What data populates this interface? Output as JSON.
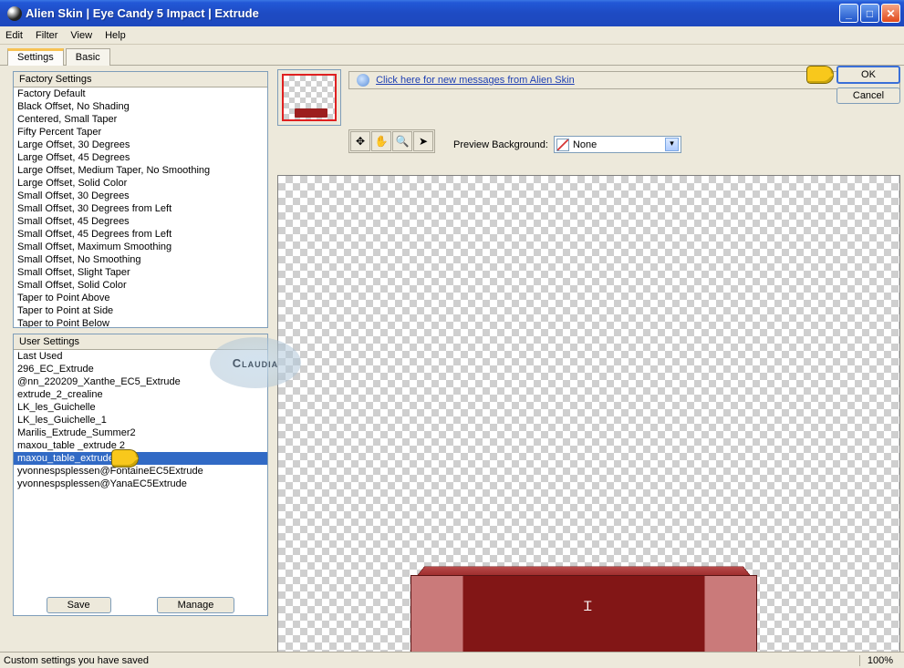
{
  "window": {
    "title": "Alien Skin  |  Eye Candy 5 Impact  |  Extrude"
  },
  "menu": {
    "edit": "Edit",
    "filter": "Filter",
    "view": "View",
    "help": "Help"
  },
  "tabs": {
    "settings": "Settings",
    "basic": "Basic"
  },
  "factory": {
    "header": "Factory Settings",
    "items": [
      "Factory Default",
      "Black Offset, No Shading",
      "Centered, Small Taper",
      "Fifty Percent Taper",
      "Large Offset, 30 Degrees",
      "Large Offset, 45 Degrees",
      "Large Offset, Medium Taper, No Smoothing",
      "Large Offset, Solid Color",
      "Small Offset, 30 Degrees",
      "Small Offset, 30 Degrees from Left",
      "Small Offset, 45 Degrees",
      "Small Offset, 45 Degrees from Left",
      "Small Offset, Maximum Smoothing",
      "Small Offset, No Smoothing",
      "Small Offset, Slight Taper",
      "Small Offset, Solid Color",
      "Taper to Point Above",
      "Taper to Point at Side",
      "Taper to Point Below"
    ]
  },
  "user": {
    "header": "User Settings",
    "items": [
      "Last Used",
      "296_EC_Extrude",
      "@nn_220209_Xanthe_EC5_Extrude",
      "extrude_2_crealine",
      "LK_les_Guichelle",
      "LK_les_Guichelle_1",
      "Marilis_Extrude_Summer2",
      "maxou_table _extrude 2",
      "maxou_table_extrude",
      "yvonnespsplessen@FontaineEC5Extrude",
      "yvonnespsplessen@YanaEC5Extrude"
    ],
    "selectedIndex": 8
  },
  "buttons": {
    "save": "Save",
    "manage": "Manage",
    "ok": "OK",
    "cancel": "Cancel"
  },
  "messageLink": "Click here for new messages from Alien Skin",
  "previewBg": {
    "label": "Preview Background:",
    "value": "None"
  },
  "status": {
    "left": "Custom settings you have saved",
    "zoom": "100%"
  },
  "watermark": "Claudia"
}
